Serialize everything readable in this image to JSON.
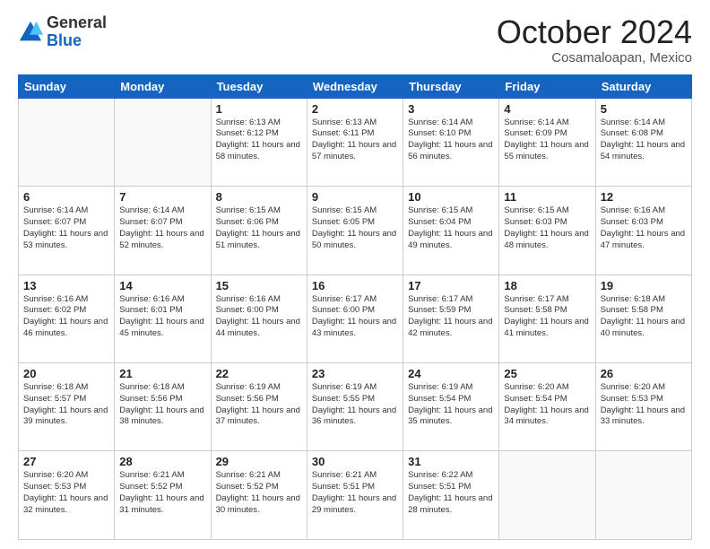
{
  "header": {
    "logo_general": "General",
    "logo_blue": "Blue",
    "month_title": "October 2024",
    "location": "Cosamaloapan, Mexico"
  },
  "days_of_week": [
    "Sunday",
    "Monday",
    "Tuesday",
    "Wednesday",
    "Thursday",
    "Friday",
    "Saturday"
  ],
  "weeks": [
    [
      {
        "day": "",
        "content": ""
      },
      {
        "day": "",
        "content": ""
      },
      {
        "day": "1",
        "content": "Sunrise: 6:13 AM\nSunset: 6:12 PM\nDaylight: 11 hours and 58 minutes."
      },
      {
        "day": "2",
        "content": "Sunrise: 6:13 AM\nSunset: 6:11 PM\nDaylight: 11 hours and 57 minutes."
      },
      {
        "day": "3",
        "content": "Sunrise: 6:14 AM\nSunset: 6:10 PM\nDaylight: 11 hours and 56 minutes."
      },
      {
        "day": "4",
        "content": "Sunrise: 6:14 AM\nSunset: 6:09 PM\nDaylight: 11 hours and 55 minutes."
      },
      {
        "day": "5",
        "content": "Sunrise: 6:14 AM\nSunset: 6:08 PM\nDaylight: 11 hours and 54 minutes."
      }
    ],
    [
      {
        "day": "6",
        "content": "Sunrise: 6:14 AM\nSunset: 6:07 PM\nDaylight: 11 hours and 53 minutes."
      },
      {
        "day": "7",
        "content": "Sunrise: 6:14 AM\nSunset: 6:07 PM\nDaylight: 11 hours and 52 minutes."
      },
      {
        "day": "8",
        "content": "Sunrise: 6:15 AM\nSunset: 6:06 PM\nDaylight: 11 hours and 51 minutes."
      },
      {
        "day": "9",
        "content": "Sunrise: 6:15 AM\nSunset: 6:05 PM\nDaylight: 11 hours and 50 minutes."
      },
      {
        "day": "10",
        "content": "Sunrise: 6:15 AM\nSunset: 6:04 PM\nDaylight: 11 hours and 49 minutes."
      },
      {
        "day": "11",
        "content": "Sunrise: 6:15 AM\nSunset: 6:03 PM\nDaylight: 11 hours and 48 minutes."
      },
      {
        "day": "12",
        "content": "Sunrise: 6:16 AM\nSunset: 6:03 PM\nDaylight: 11 hours and 47 minutes."
      }
    ],
    [
      {
        "day": "13",
        "content": "Sunrise: 6:16 AM\nSunset: 6:02 PM\nDaylight: 11 hours and 46 minutes."
      },
      {
        "day": "14",
        "content": "Sunrise: 6:16 AM\nSunset: 6:01 PM\nDaylight: 11 hours and 45 minutes."
      },
      {
        "day": "15",
        "content": "Sunrise: 6:16 AM\nSunset: 6:00 PM\nDaylight: 11 hours and 44 minutes."
      },
      {
        "day": "16",
        "content": "Sunrise: 6:17 AM\nSunset: 6:00 PM\nDaylight: 11 hours and 43 minutes."
      },
      {
        "day": "17",
        "content": "Sunrise: 6:17 AM\nSunset: 5:59 PM\nDaylight: 11 hours and 42 minutes."
      },
      {
        "day": "18",
        "content": "Sunrise: 6:17 AM\nSunset: 5:58 PM\nDaylight: 11 hours and 41 minutes."
      },
      {
        "day": "19",
        "content": "Sunrise: 6:18 AM\nSunset: 5:58 PM\nDaylight: 11 hours and 40 minutes."
      }
    ],
    [
      {
        "day": "20",
        "content": "Sunrise: 6:18 AM\nSunset: 5:57 PM\nDaylight: 11 hours and 39 minutes."
      },
      {
        "day": "21",
        "content": "Sunrise: 6:18 AM\nSunset: 5:56 PM\nDaylight: 11 hours and 38 minutes."
      },
      {
        "day": "22",
        "content": "Sunrise: 6:19 AM\nSunset: 5:56 PM\nDaylight: 11 hours and 37 minutes."
      },
      {
        "day": "23",
        "content": "Sunrise: 6:19 AM\nSunset: 5:55 PM\nDaylight: 11 hours and 36 minutes."
      },
      {
        "day": "24",
        "content": "Sunrise: 6:19 AM\nSunset: 5:54 PM\nDaylight: 11 hours and 35 minutes."
      },
      {
        "day": "25",
        "content": "Sunrise: 6:20 AM\nSunset: 5:54 PM\nDaylight: 11 hours and 34 minutes."
      },
      {
        "day": "26",
        "content": "Sunrise: 6:20 AM\nSunset: 5:53 PM\nDaylight: 11 hours and 33 minutes."
      }
    ],
    [
      {
        "day": "27",
        "content": "Sunrise: 6:20 AM\nSunset: 5:53 PM\nDaylight: 11 hours and 32 minutes."
      },
      {
        "day": "28",
        "content": "Sunrise: 6:21 AM\nSunset: 5:52 PM\nDaylight: 11 hours and 31 minutes."
      },
      {
        "day": "29",
        "content": "Sunrise: 6:21 AM\nSunset: 5:52 PM\nDaylight: 11 hours and 30 minutes."
      },
      {
        "day": "30",
        "content": "Sunrise: 6:21 AM\nSunset: 5:51 PM\nDaylight: 11 hours and 29 minutes."
      },
      {
        "day": "31",
        "content": "Sunrise: 6:22 AM\nSunset: 5:51 PM\nDaylight: 11 hours and 28 minutes."
      },
      {
        "day": "",
        "content": ""
      },
      {
        "day": "",
        "content": ""
      }
    ]
  ]
}
